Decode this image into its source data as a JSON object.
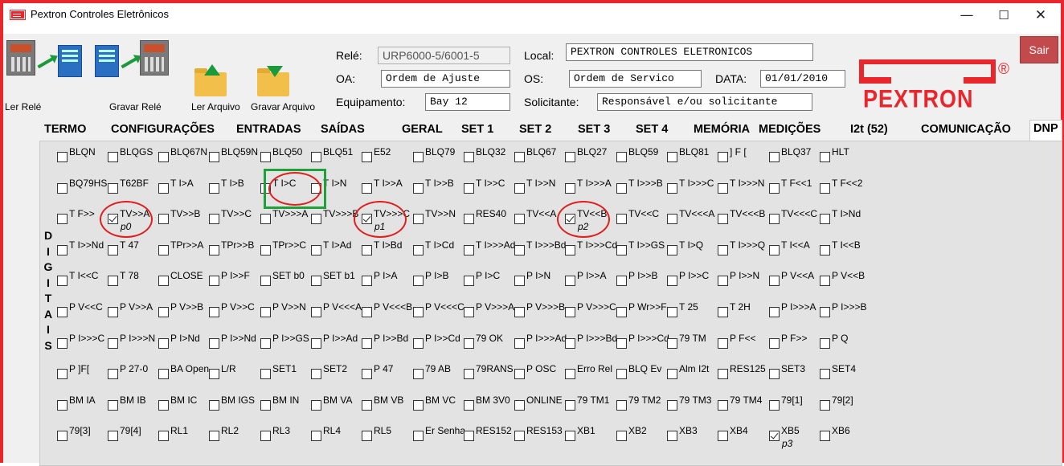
{
  "window": {
    "title": "Pextron Controles Eletrônicos",
    "min": "—",
    "max": "☐",
    "close": "✕"
  },
  "sair": "Sair",
  "toolbar": [
    {
      "name": "ler-rele-button",
      "label": "Ler Relé"
    },
    {
      "name": "gravar-rele-button",
      "label": "Gravar Relé"
    },
    {
      "name": "ler-arquivo-button",
      "label": "Ler Arquivo"
    },
    {
      "name": "gravar-arquivo-button",
      "label": "Gravar Arquivo"
    }
  ],
  "header": {
    "rele_label": "Relé:",
    "rele_value": "URP6000-5/6001-5",
    "oa_label": "OA:",
    "oa_value": "Ordem de Ajuste",
    "equip_label": "Equipamento:",
    "equip_value": "Bay 12",
    "local_label": "Local:",
    "local_value": "PEXTRON CONTROLES ELETRONICOS",
    "os_label": "OS:",
    "os_value": "Ordem de Servico",
    "data_label": "DATA:",
    "data_value": "01/01/2010",
    "solic_label": "Solicitante:",
    "solic_value": "Responsável e/ou solicitante"
  },
  "logo": {
    "text": "PEXTRON",
    "reg": "®",
    "color": "#e8262b"
  },
  "tabs": [
    "TERMO",
    "CONFIGURAÇÕES",
    "ENTRADAS",
    "SAÍDAS",
    "GERAL",
    "SET 1",
    "SET 2",
    "SET 3",
    "SET 4",
    "MEMÓRIA",
    "MEDIÇÕES",
    "I2t (52)",
    "COMUNICAÇÃO",
    "DNP"
  ],
  "active_tab": "DNP",
  "side_label": [
    "D",
    "I",
    "G",
    "I",
    "T",
    "A",
    "I",
    "S"
  ],
  "grid": [
    [
      "BLQN",
      "BLQGS",
      "BLQ67N",
      "BLQ59N",
      "BLQ50",
      "BLQ51",
      "E52",
      "BLQ79",
      "BLQ32",
      "BLQ67",
      "BLQ27",
      "BLQ59",
      "BLQ81",
      "] F [",
      "BLQ37",
      "HLT"
    ],
    [
      "BQ79HS",
      "T62BF",
      "T I>A",
      "T I>B",
      "T I>C",
      "T I>N",
      "T I>>A",
      "T I>>B",
      "T I>>C",
      "T I>>N",
      "T I>>>A",
      "T I>>>B",
      "T I>>>C",
      "T I>>>N",
      "T F<<1",
      "T F<<2"
    ],
    [
      "T F>>",
      "TV>>A",
      "TV>>B",
      "TV>>C",
      "TV>>>A",
      "TV>>>B",
      "TV>>>C",
      "TV>>N",
      "RES40",
      "TV<<A",
      "TV<<B",
      "TV<<C",
      "TV<<<A",
      "TV<<<B",
      "TV<<<C",
      "T I>Nd"
    ],
    [
      "T I>>Nd",
      "T 47",
      "TPr>>A",
      "TPr>>B",
      "TPr>>C",
      "T I>Ad",
      "T I>Bd",
      "T I>Cd",
      "T I>>>Ad",
      "T I>>>Bd",
      "T I>>>Cd",
      "T I>>GS",
      "T I>Q",
      "T I>>>Q",
      "T I<<A",
      "T I<<B"
    ],
    [
      "T I<<C",
      "T 78",
      "CLOSE",
      "P I>>F",
      "SET b0",
      "SET b1",
      "P I>A",
      "P I>B",
      "P I>C",
      "P I>N",
      "P I>>A",
      "P I>>B",
      "P I>>C",
      "P I>>N",
      "P V<<A",
      "P V<<B"
    ],
    [
      "P V<<C",
      "P V>>A",
      "P V>>B",
      "P V>>C",
      "P V>>N",
      "P V<<<A",
      "P V<<<B",
      "P V<<<C",
      "P V>>>A",
      "P V>>>B",
      "P V>>>C",
      "P Wr>>F",
      "T 25",
      "T 2H",
      "P I>>>A",
      "P I>>>B"
    ],
    [
      "P I>>>C",
      "P I>>>N",
      "P I>Nd",
      "P I>>Nd",
      "P I>>GS",
      "P I>>Ad",
      "P I>>Bd",
      "P I>>Cd",
      "79 OK",
      "P I>>>Ad",
      "P I>>>Bd",
      "P I>>>Cd",
      "79 TM",
      "P F<<",
      "P F>>",
      "P Q"
    ],
    [
      "P ]F[",
      "P 27-0",
      "BA Open",
      "L/R",
      "SET1",
      "SET2",
      "P 47",
      "79 AB",
      "79RANS",
      "P OSC",
      "Erro Rel",
      "BLQ Ev",
      "Alm I2t",
      "RES125",
      "SET3",
      "SET4"
    ],
    [
      "BM IA",
      "BM IB",
      "BM IC",
      "BM IGS",
      "BM IN",
      "BM VA",
      "BM VB",
      "BM VC",
      "BM 3V0",
      "ONLINE",
      "79 TM1",
      "79 TM2",
      "79 TM3",
      "79 TM4",
      "79[1]",
      "79[2]"
    ],
    [
      "79[3]",
      "79[4]",
      "RL1",
      "RL2",
      "RL3",
      "RL4",
      "RL5",
      "Er Senha",
      "RES152",
      "RES153",
      "XB1",
      "XB2",
      "XB3",
      "XB4",
      "XB5",
      "XB6"
    ]
  ],
  "checked": [
    [
      2,
      1,
      "p0"
    ],
    [
      2,
      6,
      "p1"
    ],
    [
      2,
      10,
      "p2"
    ],
    [
      9,
      14,
      "p3"
    ]
  ]
}
